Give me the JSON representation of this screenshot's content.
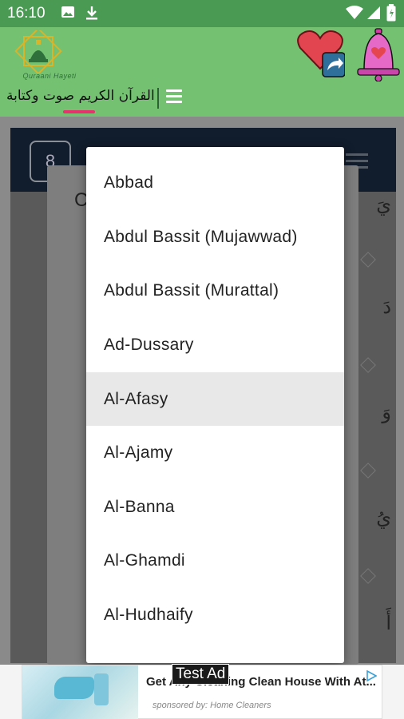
{
  "status_bar": {
    "time": "16:10",
    "icons": [
      "image-icon",
      "download-icon",
      "wifi-icon",
      "signal-icon",
      "battery-icon"
    ]
  },
  "app_bar": {
    "logo_text": "Quraani Hayeti",
    "title": "القرآن الكريم صوت وكتابة",
    "accent_color": "#e6336e",
    "bar_color": "#74c172"
  },
  "background_page": {
    "page_number": "8",
    "dialog_partial_letter": "C",
    "verse_fragments": [
      "يَ",
      "دَ",
      "وَ",
      "يُ",
      "أَ"
    ]
  },
  "dropdown": {
    "selected_index": 4,
    "items": [
      "Abbad",
      "Abdul Bassit (Mujawwad)",
      "Abdul Bassit (Murattal)",
      "Ad-Dussary",
      "Al-Afasy",
      "Al-Ajamy",
      "Al-Banna",
      "Al-Ghamdi",
      "Al-Hudhaify"
    ]
  },
  "ad": {
    "label": "Test Ad",
    "headline": "Get Any Cleaning Clean House With At...",
    "sponsor": "sponsored by: Home Cleaners"
  }
}
